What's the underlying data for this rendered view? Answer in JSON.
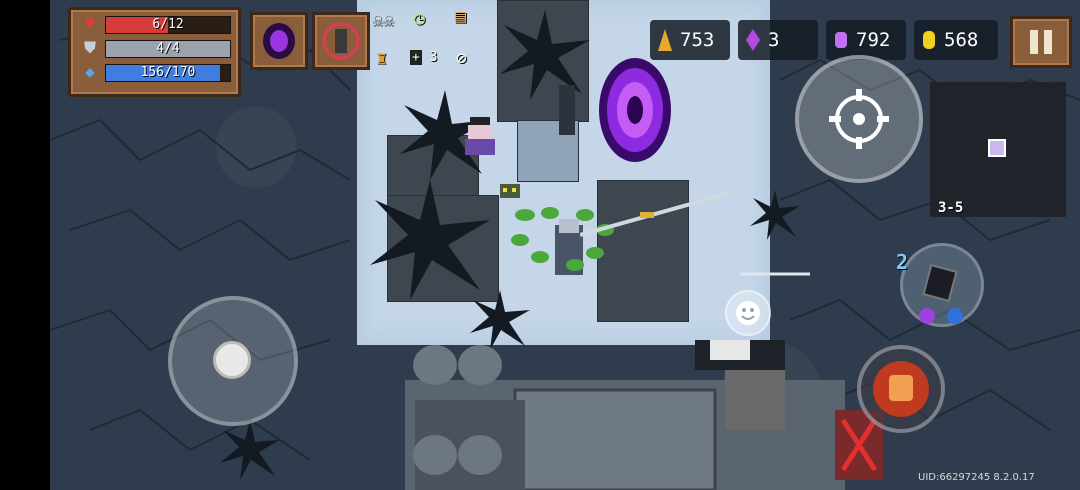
{
  "hud": {
    "health": {
      "text": "6/12",
      "fraction": 0.5,
      "color": "#d73c3c",
      "icon": "heart-icon"
    },
    "armor": {
      "text": "4/4",
      "fraction": 1.0,
      "color": "#9aa3ad",
      "icon": "shield-icon"
    },
    "energy": {
      "text": "156/170",
      "fraction": 0.918,
      "color": "#3f7de0",
      "icon": "energy-crystal-icon"
    }
  },
  "skills": [
    {
      "name": "void-summon-skill-icon"
    },
    {
      "name": "rune-skill-icon"
    }
  ],
  "buffs": {
    "stack_count": "3"
  },
  "currencies": {
    "material": {
      "value": "753",
      "icon": "material-icon",
      "color": "#e8a92b"
    },
    "crystal": {
      "value": "3",
      "icon": "crystal-icon",
      "color": "#b04ae0"
    },
    "gems": {
      "value": "792",
      "icon": "gem-icon",
      "color": "#c070f0"
    },
    "gold": {
      "value": "568",
      "icon": "gold-coin-icon",
      "color": "#f0d020"
    }
  },
  "minimap": {
    "level": "3-5"
  },
  "weapon_slot": {
    "count": "2"
  },
  "footer": {
    "uid": "UID:66297245 8.2.0.17"
  }
}
